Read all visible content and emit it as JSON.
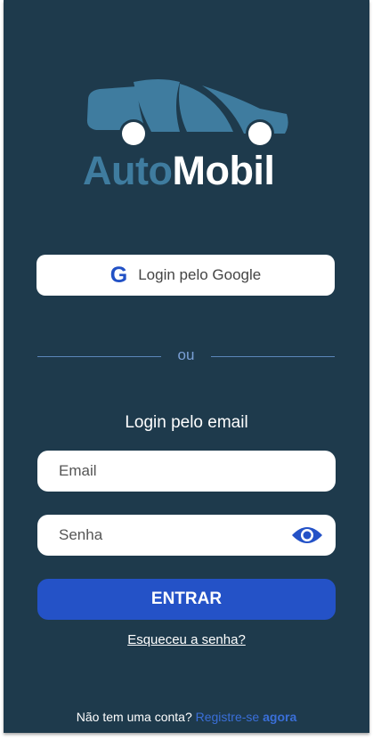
{
  "brand": {
    "name_part1": "Auto",
    "name_part2": "Mobil",
    "logo_icon": "car-icon",
    "colors": {
      "primary_text": "#3f7c9f",
      "secondary_text": "#ffffff"
    }
  },
  "google_login": {
    "icon": "G",
    "label": "Login pelo Google"
  },
  "divider": {
    "text": "ou"
  },
  "email_login": {
    "heading": "Login pelo email",
    "email_placeholder": "Email",
    "password_placeholder": "Senha",
    "password_toggle_icon": "eye-icon",
    "submit_label": "ENTRAR",
    "forgot_label": "Esqueceu a senha?"
  },
  "footer": {
    "prompt": "Não tem uma conta?",
    "register_label": "Registre-se",
    "register_emphasis": "agora"
  },
  "colors": {
    "background": "#1e3a4c",
    "accent": "#2452c7",
    "link": "#3a6fd8"
  }
}
